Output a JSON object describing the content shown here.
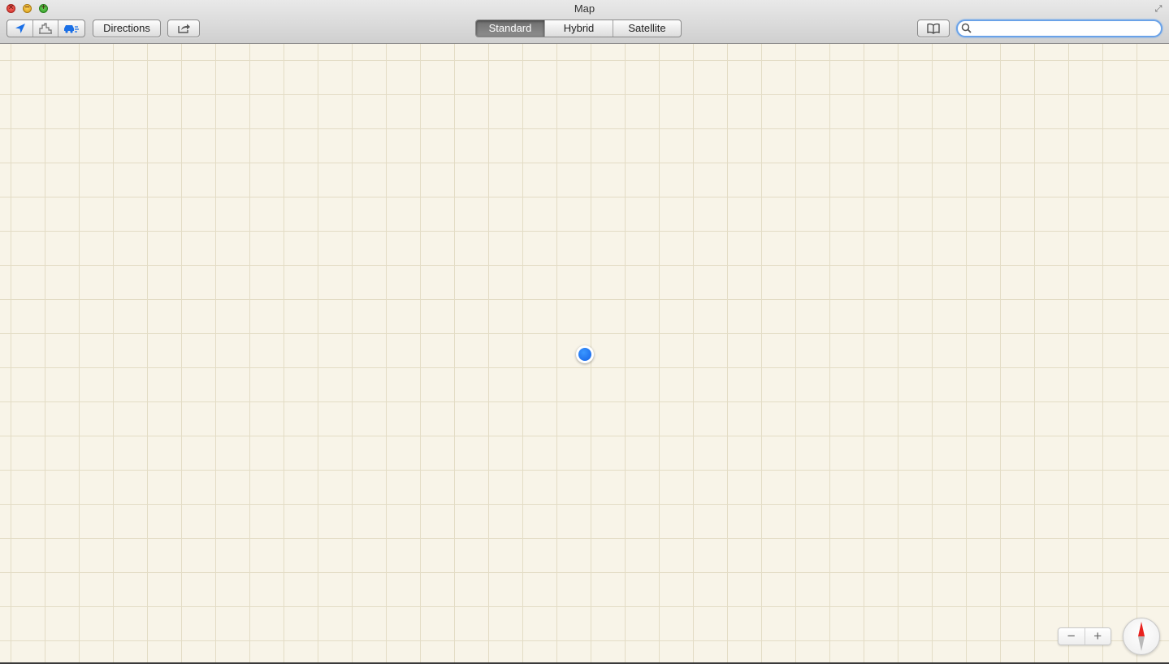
{
  "window": {
    "title": "Map",
    "controls": [
      "close",
      "minimize",
      "zoom"
    ]
  },
  "toolbar": {
    "view_icons": [
      "location-arrow-icon",
      "buildings-3d-icon",
      "traffic-car-icon"
    ],
    "directions_label": "Directions",
    "share_icon": "share-icon",
    "map_types": [
      {
        "label": "Standard",
        "selected": true
      },
      {
        "label": "Hybrid",
        "selected": false
      },
      {
        "label": "Satellite",
        "selected": false
      }
    ],
    "bookmarks_icon": "bookmarks-book-icon",
    "search": {
      "value": "",
      "placeholder": ""
    }
  },
  "map": {
    "zoom_out_label": "−",
    "zoom_in_label": "+",
    "compass_icon": "compass-icon",
    "colors": {
      "background": "#f8f4e8",
      "grid": "#e3dcc5",
      "user_location": "#1f6ff0",
      "compass_north": "#e8221f"
    }
  }
}
